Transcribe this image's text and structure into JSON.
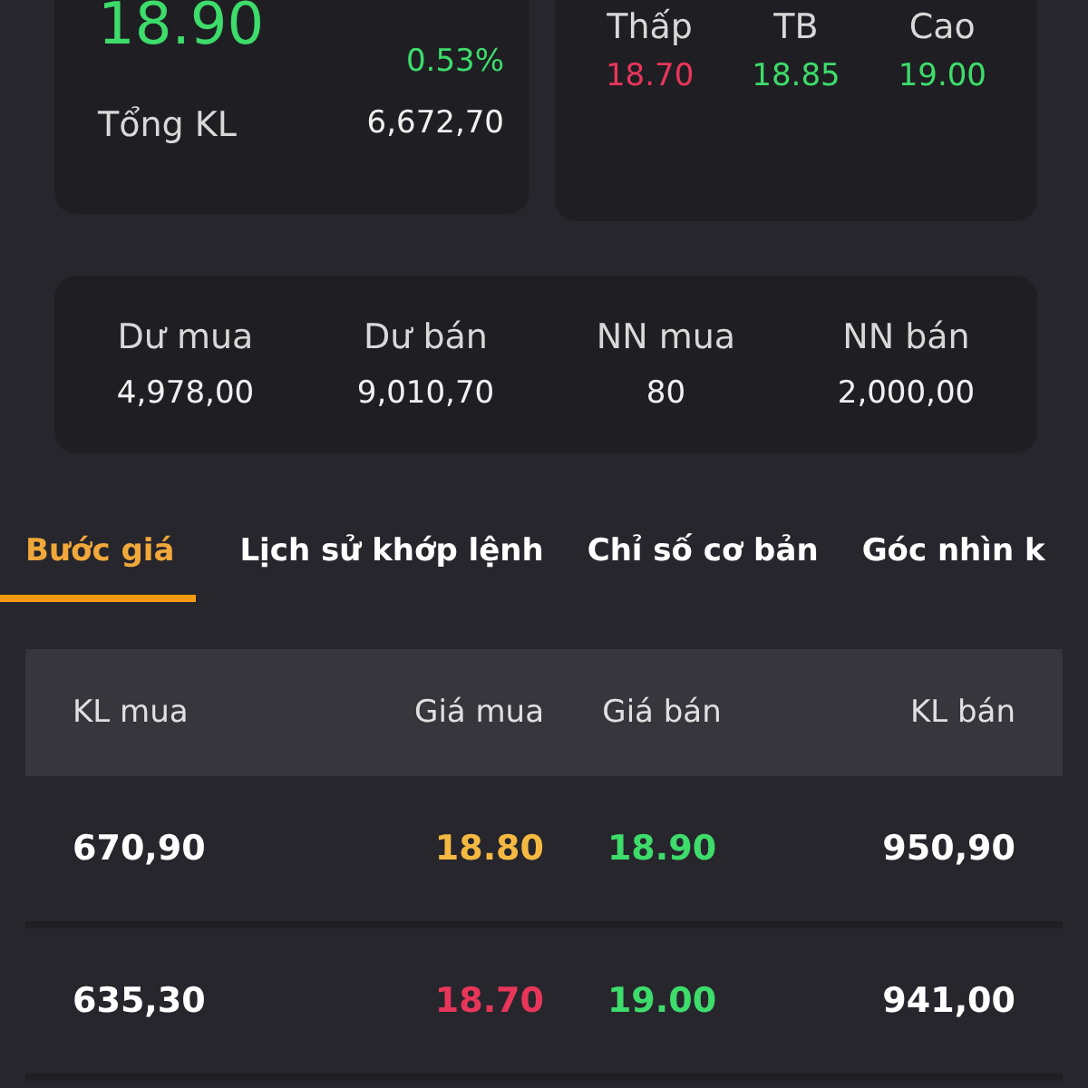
{
  "summary": {
    "price": {
      "text": "18.90",
      "color": "#3ddc6b"
    },
    "change": {
      "text": "0.53%",
      "color": "#3ddc6b"
    },
    "volume_label": "Tổng KL",
    "volume": "6,672,70"
  },
  "range": [
    {
      "label": "Thấp",
      "value": "18.70",
      "color": "#e8365a"
    },
    {
      "label": "TB",
      "value": "18.85",
      "color": "#3ddc6b"
    },
    {
      "label": "Cao",
      "value": "19.00",
      "color": "#3ddc6b"
    }
  ],
  "stats": [
    {
      "label": "Dư mua",
      "value": "4,978,00"
    },
    {
      "label": "Dư bán",
      "value": "9,010,70"
    },
    {
      "label": "NN mua",
      "value": "80"
    },
    {
      "label": "NN bán",
      "value": "2,000,00"
    }
  ],
  "tabs": [
    {
      "label": "Bước giá",
      "selected": true
    },
    {
      "label": "Lịch sử khớp lệnh",
      "selected": false
    },
    {
      "label": "Chỉ số cơ bản",
      "selected": false
    },
    {
      "label": "Góc nhìn k",
      "selected": false
    }
  ],
  "table": {
    "columns": [
      "KL mua",
      "Giá mua",
      "Giá bán",
      "KL bán"
    ],
    "rows": [
      {
        "bid_volume": "670,90",
        "bid": {
          "text": "18.80",
          "color": "#f5b942"
        },
        "ask": {
          "text": "18.90",
          "color": "#3ddc6b"
        },
        "ask_volume": "950,90"
      },
      {
        "bid_volume": "635,30",
        "bid": {
          "text": "18.70",
          "color": "#e8365a"
        },
        "ask": {
          "text": "19.00",
          "color": "#3ddc6b"
        },
        "ask_volume": "941,00"
      }
    ]
  }
}
